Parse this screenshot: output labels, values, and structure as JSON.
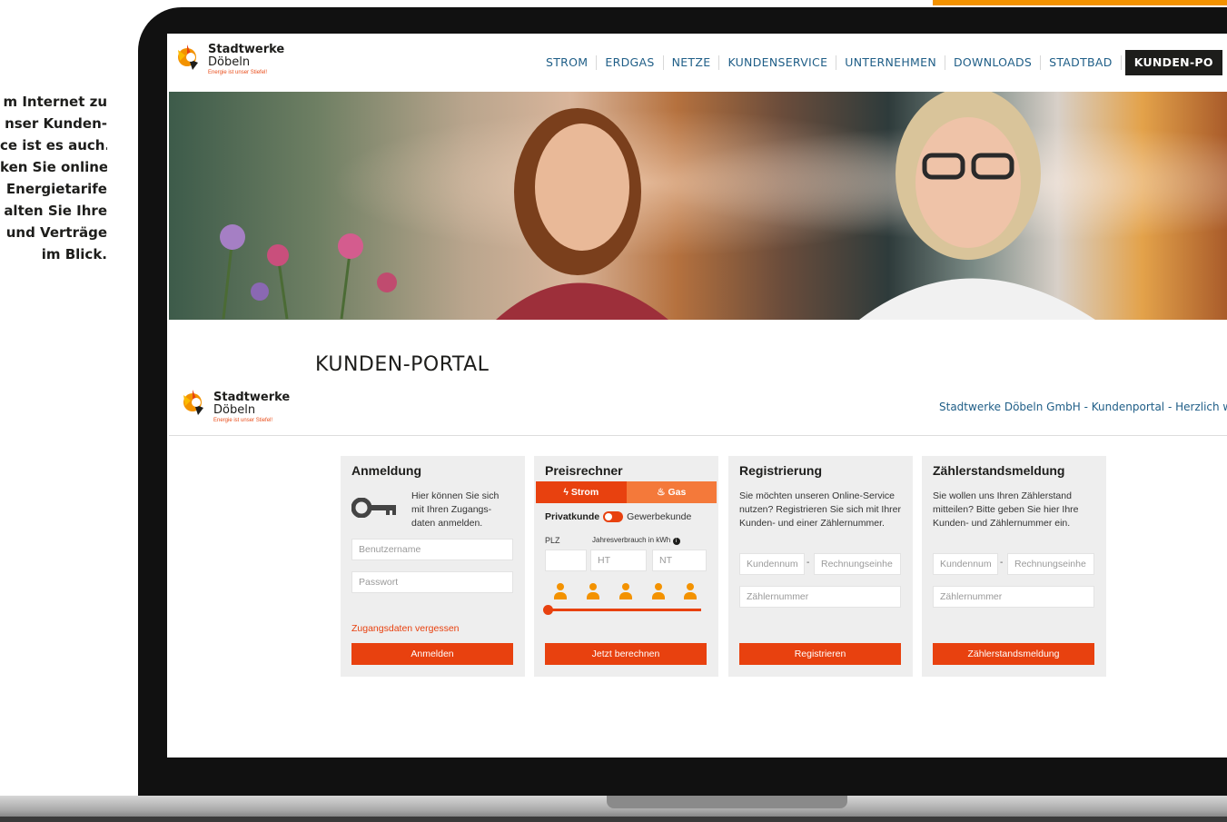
{
  "side_text": {
    "lines": [
      "m Internet zu",
      "nser Kunden-",
      "ce ist es auch.",
      "ken Sie online",
      "Energietarife",
      "alten Sie Ihre",
      "und Verträge",
      "im Blick."
    ]
  },
  "logo": {
    "name": "Stadtwerke",
    "city": "Döbeln",
    "tagline": "Energie ist unser Stiefel!"
  },
  "nav": {
    "items": [
      {
        "label": "STROM"
      },
      {
        "label": "ERDGAS"
      },
      {
        "label": "NETZE"
      },
      {
        "label": "KUNDENSERVICE"
      },
      {
        "label": "UNTERNEHMEN"
      },
      {
        "label": "DOWNLOADS"
      },
      {
        "label": "STADTBAD"
      },
      {
        "label": "KUNDEN-PO"
      }
    ]
  },
  "page": {
    "title": "KUNDEN-PORTAL",
    "welcome": "Stadtwerke Döbeln GmbH - Kundenportal - Herzlich willkom"
  },
  "anmeldung": {
    "title": "Anmeldung",
    "text": "Hier können Sie sich mit Ihren Zugangs-daten anmelden.",
    "user_placeholder": "Benutzername",
    "password_placeholder": "Passwort",
    "forgot_link": "Zugangsdaten vergessen",
    "button": "Anmelden"
  },
  "preisrechner": {
    "title": "Preisrechner",
    "tab_strom": "Strom",
    "tab_gas": "Gas",
    "private": "Privatkunde",
    "business": "Gewerbekunde",
    "plz_label": "PLZ",
    "consumption_label": "Jahresverbrauch in kWh",
    "ht_placeholder": "HT",
    "nt_placeholder": "NT",
    "household_size": 1,
    "button": "Jetzt berechnen"
  },
  "registrierung": {
    "title": "Registrierung",
    "text": "Sie möchten unseren Online-Service nutzen? Registrieren Sie sich mit Ihrer Kunden- und einer Zählernummer.",
    "customer_placeholder": "Kundennum",
    "invoice_placeholder": "Rechnungseinhe",
    "meter_placeholder": "Zählernummer",
    "button": "Registrieren"
  },
  "zaehler": {
    "title": "Zählerstandsmeldung",
    "text": "Sie wollen uns Ihren Zählerstand mitteilen? Bitte geben Sie hier Ihre Kunden- und Zählernummer ein.",
    "customer_placeholder": "Kundennum",
    "invoice_placeholder": "Rechnungseinhe",
    "meter_placeholder": "Zählernummer",
    "button": "Zählerstandsmeldung"
  },
  "colors": {
    "accent": "#e8410f",
    "nav_text": "#1f5e87",
    "panel_bg": "#eeeeee"
  }
}
